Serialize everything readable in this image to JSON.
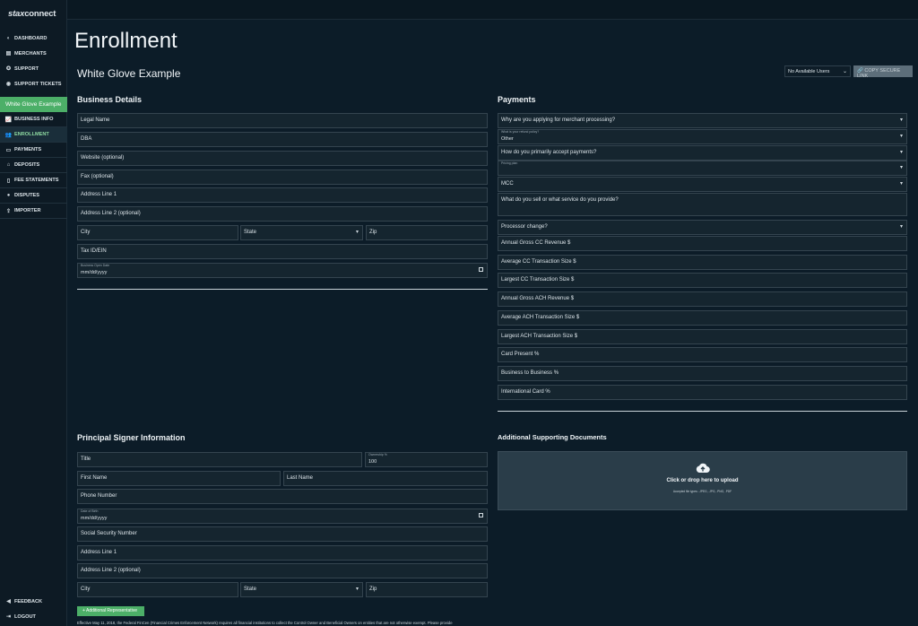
{
  "app": {
    "logo_prefix": "stax",
    "logo_suffix": "connect"
  },
  "sidebar": {
    "items": [
      {
        "label": "DASHBOARD",
        "icon": "dashboard-icon"
      },
      {
        "label": "MERCHANTS",
        "icon": "store-icon"
      },
      {
        "label": "SUPPORT",
        "icon": "lifebuoy-icon"
      },
      {
        "label": "SUPPORT TICKETS",
        "icon": "ticket-icon"
      }
    ],
    "group_label": "White Glove Example",
    "sub_items": [
      {
        "label": "BUSINESS INFO",
        "icon": "chart-icon"
      },
      {
        "label": "ENROLLMENT",
        "icon": "users-icon"
      },
      {
        "label": "PAYMENTS",
        "icon": "card-icon"
      },
      {
        "label": "DEPOSITS",
        "icon": "bank-icon"
      },
      {
        "label": "FEE STATEMENTS",
        "icon": "document-icon"
      },
      {
        "label": "DISPUTES",
        "icon": "alert-icon"
      },
      {
        "label": "IMPORTER",
        "icon": "upload-icon"
      }
    ],
    "bottom": [
      {
        "label": "FEEDBACK",
        "icon": "megaphone-icon"
      },
      {
        "label": "LOGOUT",
        "icon": "logout-icon"
      }
    ]
  },
  "page": {
    "title": "Enrollment",
    "subtitle": "White Glove Example",
    "users_select": "No Available Users",
    "copy_link": "COPY SECURE LINK"
  },
  "business": {
    "heading": "Business Details",
    "legal_name": "Legal Name",
    "dba": "DBA",
    "website": "Website (optional)",
    "fax": "Fax (optional)",
    "address1": "Address Line 1",
    "address2": "Address Line 2 (optional)",
    "city": "City",
    "state": "State",
    "zip": "Zip",
    "tax_id": "Tax ID/EIN",
    "open_date_label": "Business Open Date",
    "open_date_value": "mm/dd/yyyy"
  },
  "payments": {
    "heading": "Payments",
    "why": "Why are you applying for merchant processing?",
    "refund_label": "What is your refund policy?",
    "refund_value": "Other",
    "how_accept": "How do you primarily accept payments?",
    "pricing_label": "Pricing plan",
    "mcc": "MCC",
    "what_sell": "What do you sell or what service do you provide?",
    "processor_change": "Processor change?",
    "annual_cc": "Annual Gross CC Revenue $",
    "avg_cc": "Average CC Transaction Size $",
    "largest_cc": "Largest CC Transaction Size $",
    "annual_ach": "Annual Gross ACH Revenue $",
    "avg_ach": "Average ACH Transaction Size $",
    "largest_ach": "Largest ACH Transaction Size $",
    "card_present": "Card Present %",
    "b2b": "Business to Business %",
    "international": "International Card %"
  },
  "signer": {
    "heading": "Principal Signer Information",
    "title": "Title",
    "ownership_label": "Ownership %",
    "ownership_value": "100",
    "first_name": "First Name",
    "last_name": "Last Name",
    "phone": "Phone Number",
    "dob_label": "Date of Birth",
    "dob_value": "mm/dd/yyyy",
    "ssn": "Social Security Number",
    "address1": "Address Line 1",
    "address2": "Address Line 2 (optional)",
    "city": "City",
    "state": "State",
    "zip": "Zip",
    "add_rep": "+ Additional Representative",
    "fine_print": "Effective May 11, 2018, the Federal FinCen (Financial Crimes Enforcement Network) requires all financial institutions to collect the Control Owner and Beneficial Owners on entities that are not otherwise exempt. Please provide"
  },
  "documents": {
    "heading": "Additional Supporting Documents",
    "upload_text": "Click or drop here to upload",
    "upload_sub": "Accepted file types: .JPEG, .JPG, .PNG, .PDF"
  }
}
